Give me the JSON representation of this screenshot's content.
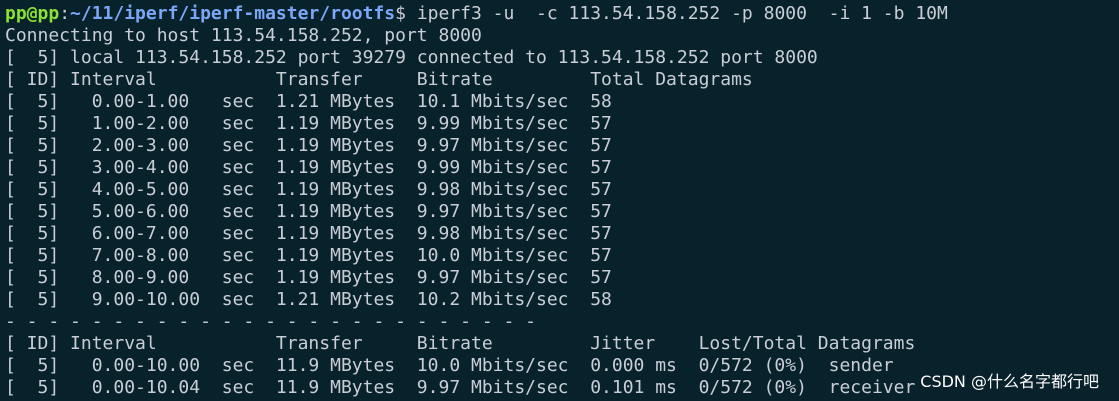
{
  "prompt": {
    "user_host": "pp@pp",
    "colon": ":",
    "path": "~/11/iperf/iperf-master/rootfs",
    "dollar": "$",
    "command": " iperf3 -u  -c 113.54.158.252 -p 8000  -i 1 -b 10M"
  },
  "output": {
    "connecting": "Connecting to host 113.54.158.252, port 8000",
    "local": "[  5] local 113.54.158.252 port 39279 connected to 113.54.158.252 port 8000",
    "header": "[ ID] Interval           Transfer     Bitrate         Total Datagrams",
    "rows": [
      "[  5]   0.00-1.00   sec  1.21 MBytes  10.1 Mbits/sec  58",
      "[  5]   1.00-2.00   sec  1.19 MBytes  9.99 Mbits/sec  57",
      "[  5]   2.00-3.00   sec  1.19 MBytes  9.97 Mbits/sec  57",
      "[  5]   3.00-4.00   sec  1.19 MBytes  9.99 Mbits/sec  57",
      "[  5]   4.00-5.00   sec  1.19 MBytes  9.98 Mbits/sec  57",
      "[  5]   5.00-6.00   sec  1.19 MBytes  9.97 Mbits/sec  57",
      "[  5]   6.00-7.00   sec  1.19 MBytes  9.98 Mbits/sec  57",
      "[  5]   7.00-8.00   sec  1.19 MBytes  10.0 Mbits/sec  57",
      "[  5]   8.00-9.00   sec  1.19 MBytes  9.97 Mbits/sec  57",
      "[  5]   9.00-10.00  sec  1.21 MBytes  10.2 Mbits/sec  58"
    ],
    "separator": "- - - - - - - - - - - - - - - - - - - - - - - - -",
    "summary_header": "[ ID] Interval           Transfer     Bitrate         Jitter    Lost/Total Datagrams",
    "summary_sender": "[  5]   0.00-10.00  sec  11.9 MBytes  10.0 Mbits/sec  0.000 ms  0/572 (0%)  sender",
    "summary_receiver": "[  5]   0.00-10.04  sec  11.9 MBytes  9.97 Mbits/sec  0.101 ms  0/572 (0%)  receiver"
  },
  "watermark": "CSDN @什么名字都行吧",
  "colors": {
    "background": "#08222b",
    "text": "#c9ced6",
    "prompt_user": "#8ae234",
    "prompt_path": "#7ca6f7"
  }
}
